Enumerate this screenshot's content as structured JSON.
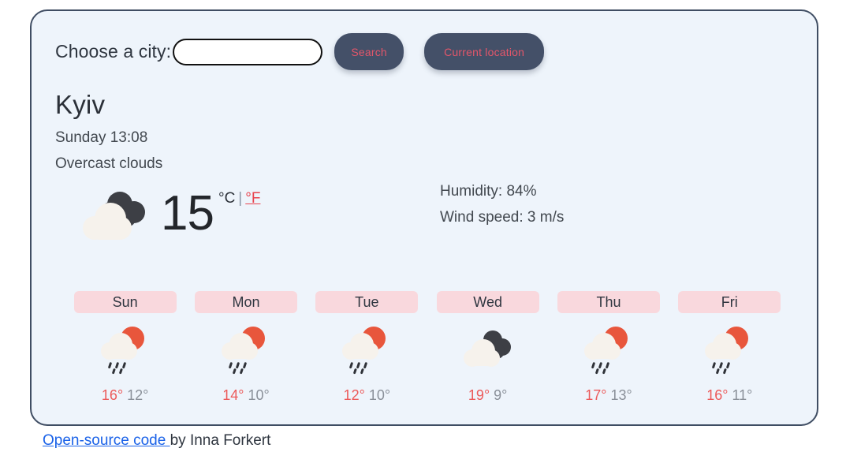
{
  "search": {
    "label": "Choose a city:",
    "input_value": "",
    "input_placeholder": "",
    "search_button": "Search",
    "location_button": "Current location"
  },
  "current": {
    "city": "Kyiv",
    "datetime": "Sunday 13:08",
    "description": "Overcast clouds",
    "temperature": "15",
    "unit_celsius": "°C",
    "unit_separator": "|",
    "unit_fahrenheit": "°F",
    "icon": "overcast-clouds-icon",
    "humidity": "Humidity: 84%",
    "wind": "Wind speed: 3 m/s"
  },
  "forecast": [
    {
      "day": "Sun",
      "icon": "sun-rain-icon",
      "max": "16°",
      "min": "12°"
    },
    {
      "day": "Mon",
      "icon": "sun-rain-icon",
      "max": "14°",
      "min": "10°"
    },
    {
      "day": "Tue",
      "icon": "sun-rain-icon",
      "max": "12°",
      "min": "10°"
    },
    {
      "day": "Wed",
      "icon": "overcast-clouds-icon",
      "max": "19°",
      "min": "9°"
    },
    {
      "day": "Thu",
      "icon": "sun-rain-icon",
      "max": "17°",
      "min": "13°"
    },
    {
      "day": "Fri",
      "icon": "sun-rain-icon",
      "max": "16°",
      "min": "11°"
    }
  ],
  "footer": {
    "link_text": "Open-source code ",
    "author_text": "by Inna Forkert"
  },
  "colors": {
    "card_background": "#eef4fb",
    "card_border": "#3f4d63",
    "button_background": "#445068",
    "button_text": "#e3566a",
    "day_badge": "#f9d8dd",
    "temp_max": "#ec5a5a",
    "temp_min": "#8a9099",
    "sun": "#e8563c",
    "cloud_light": "#f6f2ec",
    "cloud_dark": "#3d3f45",
    "link": "#1a62e8"
  }
}
